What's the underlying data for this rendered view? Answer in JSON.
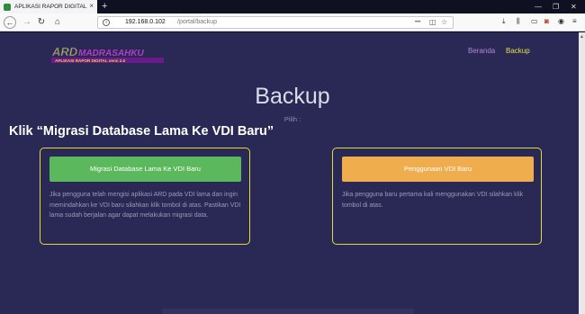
{
  "browser": {
    "tab_title": "APLIKASI RAPOR DIGITAL",
    "tab_close": "×",
    "new_tab": "+",
    "url_host": "192.168.0.102",
    "url_path": "/portal/backup",
    "url_dots": "•••",
    "window_minimize": "—",
    "window_restore": "❐",
    "window_close": "✕"
  },
  "navbar": {
    "beranda": "Beranda",
    "backup": "Backup"
  },
  "logo": {
    "main": "ARD",
    "brand": "MADRASAHKU",
    "sub": "APLIKASI RAPOR DIGITAL versi 2.0"
  },
  "main": {
    "heading": "Backup",
    "prompt": "Pilih :",
    "annotation": "Klik “Migrasi Database Lama Ke VDI Baru”"
  },
  "cards": [
    {
      "button": "Migrasi Database Lama Ke VDI Baru",
      "text": "Jika pengguna telah mengisi aplikasi ARD pada VDI lama dan ingin memindahkan ke VDI baru silahkan klik tombol di atas. Pastikan VDI lama sudah berjalan agar dapat melakukan migrasi data."
    },
    {
      "button": "Penggunaan VDI Baru",
      "text": "Jika pengguna baru pertama kali menggunakan VDI silahkan klik tombol di atas."
    }
  ],
  "colors": {
    "page_bg": "#2a2955",
    "card_border": "#e2dc3a",
    "btn_green": "#5cb85c",
    "btn_orange": "#f0ad4e",
    "nav_beranda": "#b18ad6",
    "nav_backup": "#e4e14b"
  }
}
